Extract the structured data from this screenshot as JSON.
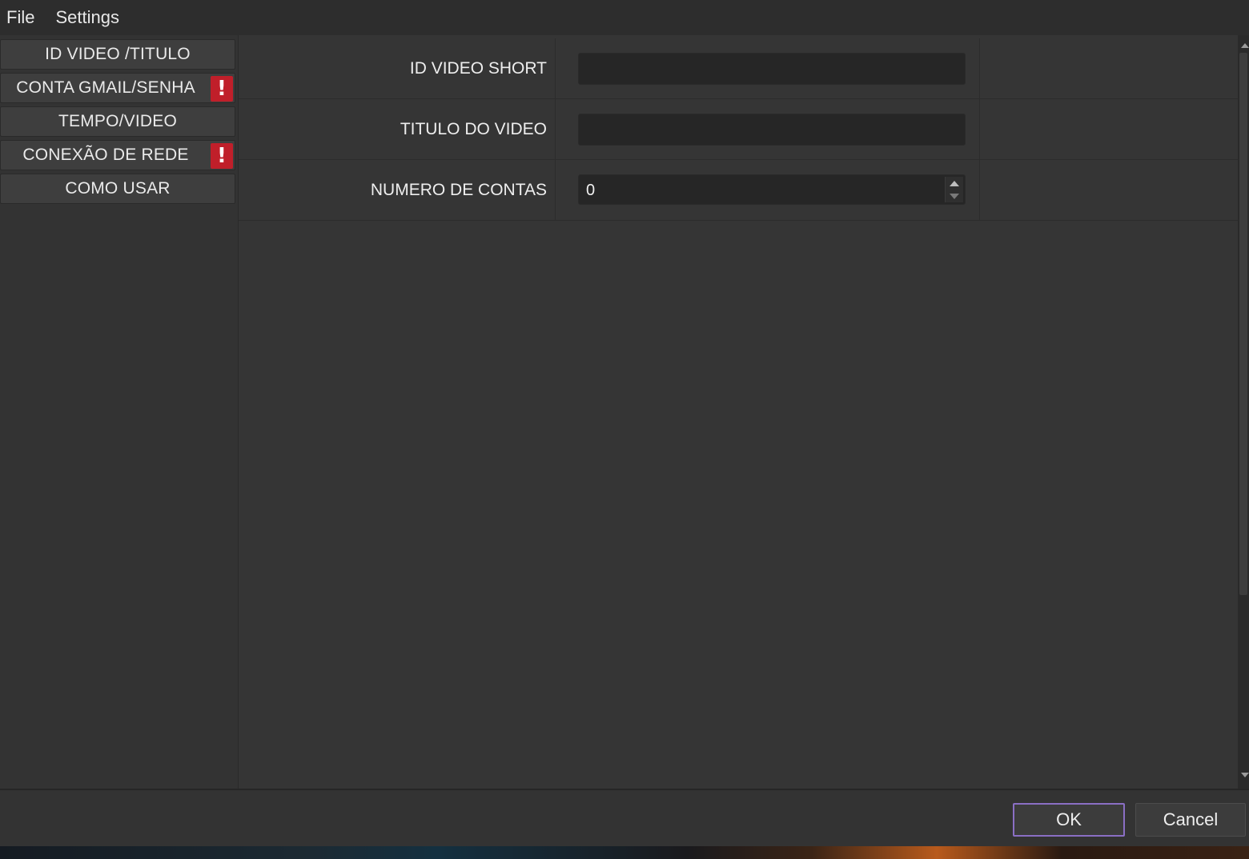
{
  "menubar": {
    "items": [
      {
        "label": "File"
      },
      {
        "label": "Settings"
      }
    ]
  },
  "sidebar": {
    "items": [
      {
        "label": "ID VIDEO /TITULO",
        "warning": false
      },
      {
        "label": "CONTA GMAIL/SENHA",
        "warning": true
      },
      {
        "label": "TEMPO/VIDEO",
        "warning": false
      },
      {
        "label": "CONEXÃO DE REDE",
        "warning": true
      },
      {
        "label": "COMO USAR",
        "warning": false
      }
    ],
    "warning_glyph": "!",
    "warning_color": "#c01f2a"
  },
  "form": {
    "fields": [
      {
        "label": "ID VIDEO SHORT",
        "value": "",
        "placeholder": ""
      },
      {
        "label": "TITULO DO VIDEO",
        "value": "",
        "placeholder": ""
      },
      {
        "label": "NUMERO DE CONTAS",
        "value": "0"
      }
    ]
  },
  "footer": {
    "ok_label": "OK",
    "cancel_label": "Cancel",
    "ok_focus_color": "#8a6fc4"
  }
}
